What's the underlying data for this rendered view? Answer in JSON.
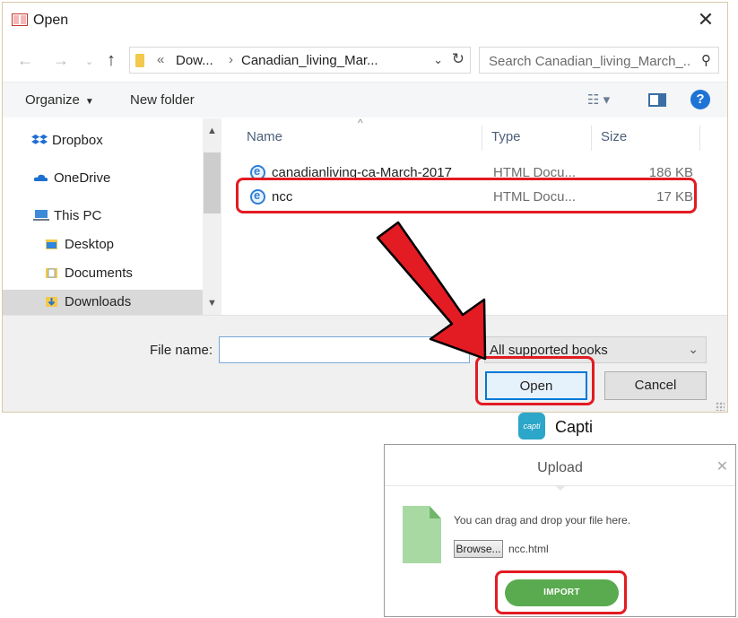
{
  "open_dialog": {
    "title": "Open",
    "address": {
      "overflow": "«",
      "crumbs": [
        "Dow...",
        "Canadian_living_Mar..."
      ],
      "separator": "›"
    },
    "search_placeholder": "Search Canadian_living_March_...",
    "toolbar": {
      "organize_label": "Organize",
      "new_folder_label": "New folder"
    },
    "nav_items": [
      {
        "label": "Dropbox",
        "icon": "dropbox-icon"
      },
      {
        "label": "OneDrive",
        "icon": "onedrive-icon"
      },
      {
        "label": "This PC",
        "icon": "computer-icon"
      },
      {
        "label": "Desktop",
        "icon": "desktop-folder-icon"
      },
      {
        "label": "Documents",
        "icon": "documents-folder-icon"
      },
      {
        "label": "Downloads",
        "icon": "downloads-folder-icon",
        "selected": true
      }
    ],
    "columns": {
      "name": "Name",
      "type": "Type",
      "size": "Size"
    },
    "files": [
      {
        "name": "canadianliving-ca-March-2017",
        "type": "HTML Docu...",
        "size": "186 KB"
      },
      {
        "name": "ncc",
        "type": "HTML Docu...",
        "size": "17 KB"
      }
    ],
    "file_name_label": "File name:",
    "file_name_value": "",
    "file_type_value": "All supported books",
    "open_button": "Open",
    "cancel_button": "Cancel"
  },
  "capti": {
    "logo_text": "capti",
    "name": "Capti",
    "upload": {
      "title": "Upload",
      "hint": "You can drag and drop your file here.",
      "browse_label": "Browse...",
      "selected_file": "ncc.html",
      "import_label": "IMPORT"
    }
  },
  "colors": {
    "highlight": "#e31b23",
    "import_green": "#5aaa4f",
    "accent_blue": "#0078d7"
  }
}
